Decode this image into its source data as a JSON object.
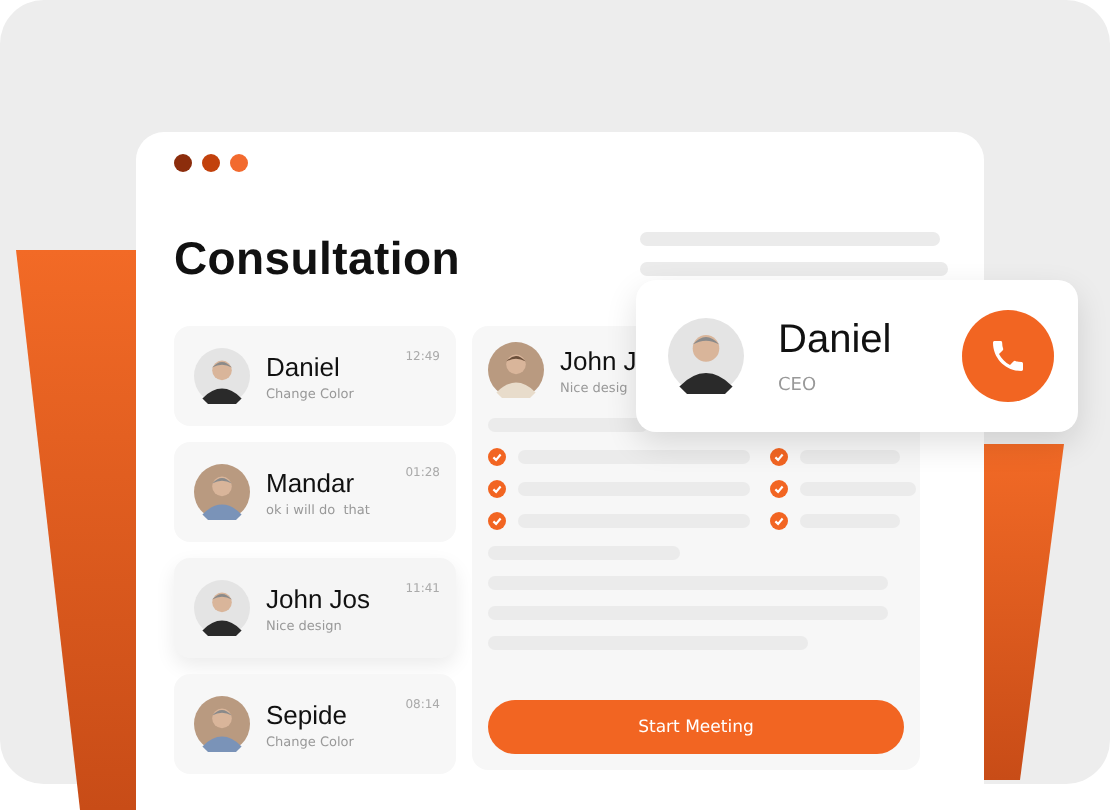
{
  "window": {
    "title": "Consultation"
  },
  "chats": [
    {
      "name": "Daniel",
      "message": "Change Color",
      "time": "12:49",
      "selected": false
    },
    {
      "name": "Mandar",
      "message": "ok i will do  that",
      "time": "01:28",
      "selected": false
    },
    {
      "name": "John Jos",
      "message": "Nice design",
      "time": "11:41",
      "selected": true
    },
    {
      "name": "Sepide",
      "message": "Change Color",
      "time": "08:14",
      "selected": false
    }
  ],
  "detail": {
    "name": "John J",
    "message": "Nice desig",
    "button": "Start Meeting"
  },
  "call": {
    "name": "Daniel",
    "role": "CEO"
  }
}
